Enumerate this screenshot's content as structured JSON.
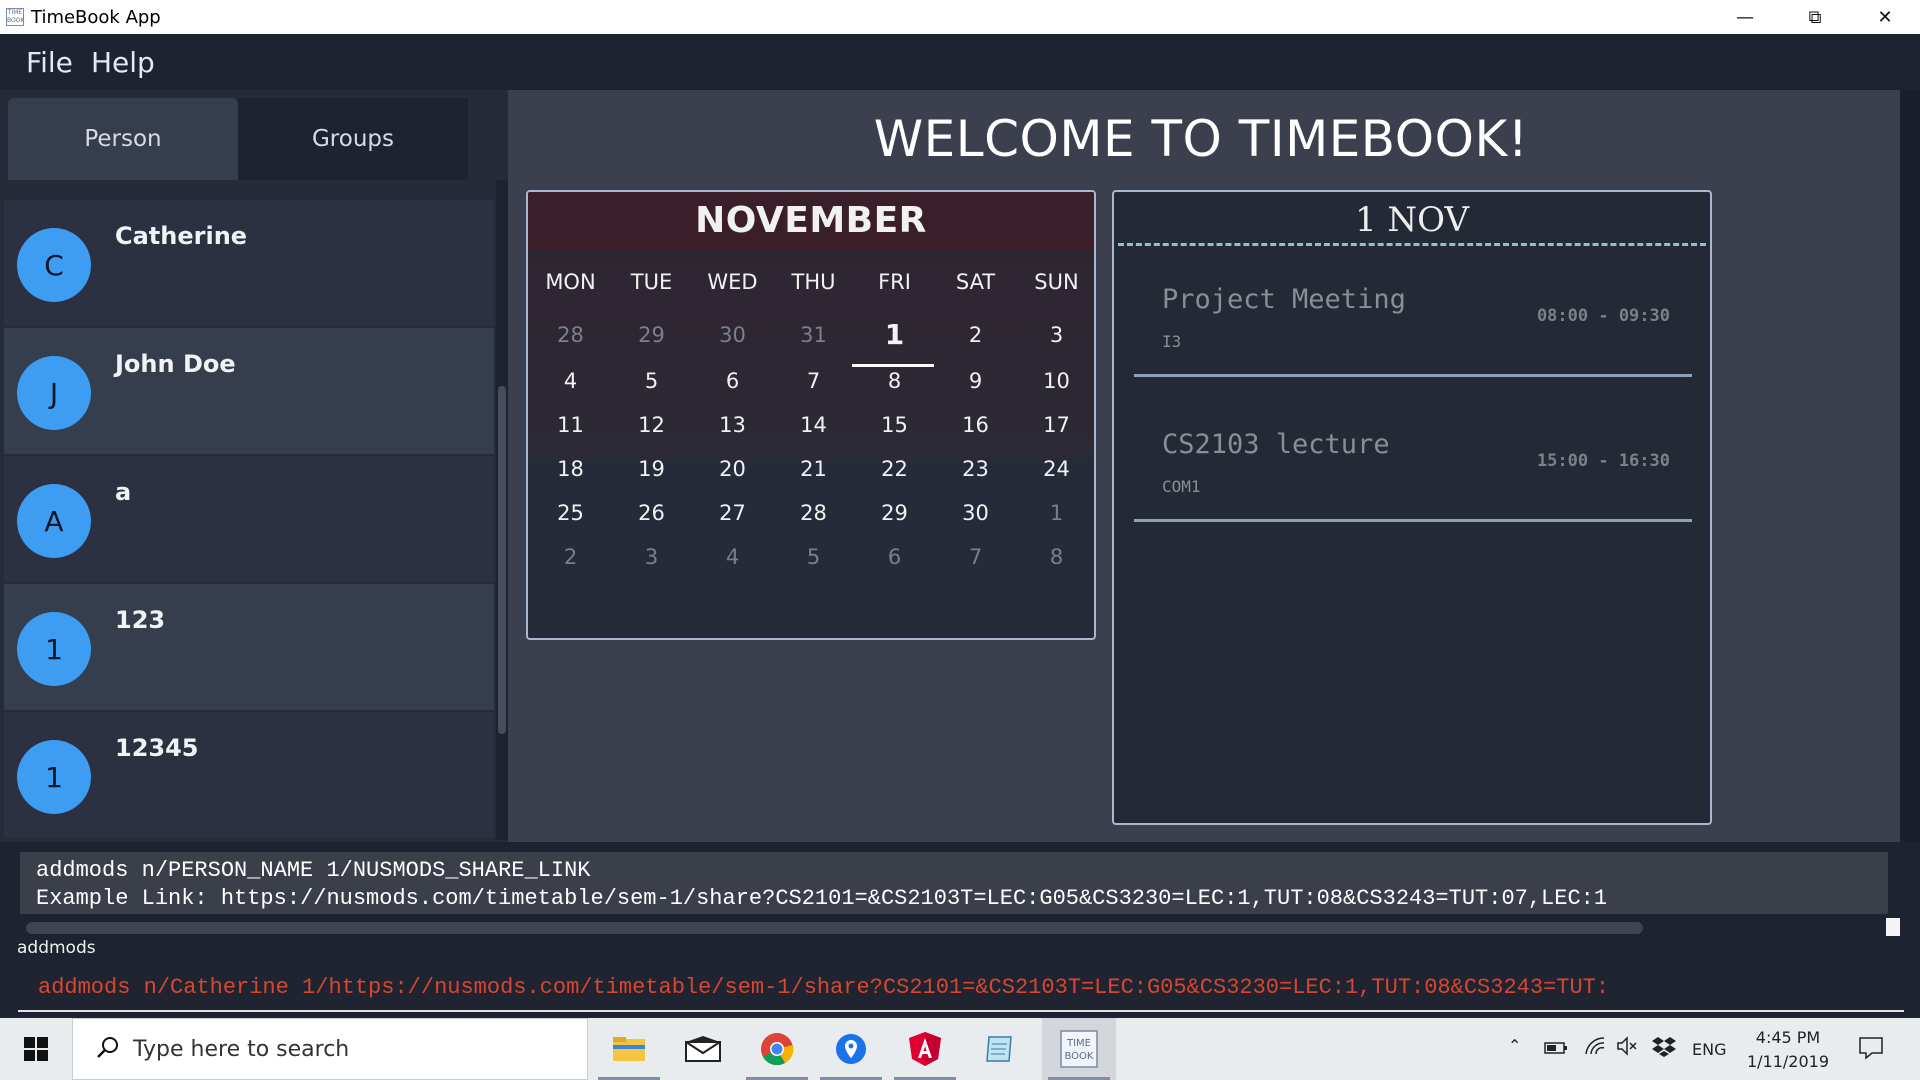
{
  "window": {
    "title": "TimeBook App",
    "app_icon_text": "TIME BOOK",
    "controls": [
      "minimize",
      "restore",
      "close"
    ]
  },
  "menu": {
    "file": "File",
    "help": "Help"
  },
  "tabs": {
    "person": "Person",
    "groups": "Groups",
    "active": "Person"
  },
  "persons": [
    {
      "initial": "C",
      "name": "Catherine"
    },
    {
      "initial": "J",
      "name": "John Doe"
    },
    {
      "initial": "A",
      "name": "a"
    },
    {
      "initial": "1",
      "name": "123"
    },
    {
      "initial": "1",
      "name": "12345"
    }
  ],
  "welcome": "WELCOME TO TIMEBOOK!",
  "calendar": {
    "month": "NOVEMBER",
    "weekdays": [
      "MON",
      "TUE",
      "WED",
      "THU",
      "FRI",
      "SAT",
      "SUN"
    ],
    "weeks": [
      [
        "28",
        "29",
        "30",
        "31",
        "1",
        "2",
        "3"
      ],
      [
        "4",
        "5",
        "6",
        "7",
        "8",
        "9",
        "10"
      ],
      [
        "11",
        "12",
        "13",
        "14",
        "15",
        "16",
        "17"
      ],
      [
        "18",
        "19",
        "20",
        "21",
        "22",
        "23",
        "24"
      ],
      [
        "25",
        "26",
        "27",
        "28",
        "29",
        "30",
        "1"
      ],
      [
        "2",
        "3",
        "4",
        "5",
        "6",
        "7",
        "8"
      ]
    ],
    "selected_day": "1"
  },
  "day_view": {
    "title": "1 NOV",
    "events": [
      {
        "title": "Project Meeting",
        "location": "I3",
        "time": "08:00 - 09:30"
      },
      {
        "title": "CS2103 lecture",
        "location": "COM1",
        "time": "15:00 - 16:30"
      }
    ]
  },
  "result": {
    "line1": "addmods n/PERSON_NAME 1/NUSMODS_SHARE_LINK",
    "line2": "Example Link: https://nusmods.com/timetable/sem-1/share?CS2101=&CS2103T=LEC:G05&CS3230=LEC:1,TUT:08&CS3243=TUT:07,LEC:1"
  },
  "status_label": "addmods",
  "command_input": "addmods n/Catherine 1/https://nusmods.com/timetable/sem-1/share?CS2101=&CS2103T=LEC:G05&CS3230=LEC:1,TUT:08&CS3243=TUT:",
  "taskbar": {
    "search_placeholder": "Type here to search",
    "apps": [
      "file-explorer",
      "mail",
      "chrome",
      "maps",
      "angular",
      "notepad",
      "timebook"
    ],
    "active_app": "timebook",
    "tray_lang": "ENG",
    "time": "4:45 PM",
    "date": "1/11/2019"
  }
}
